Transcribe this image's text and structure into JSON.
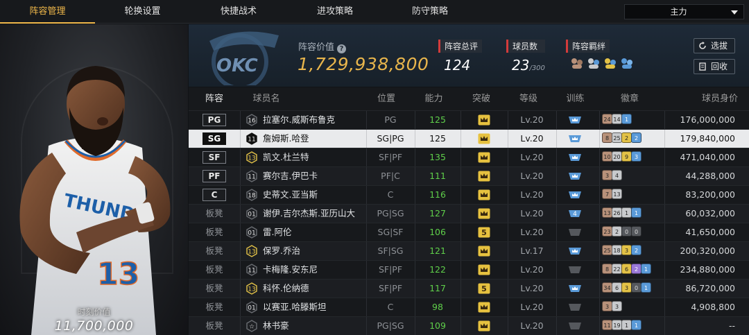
{
  "nav": {
    "tabs": [
      "阵容管理",
      "轮换设置",
      "快捷战术",
      "进攻策略",
      "防守策略"
    ],
    "active_tab": 0,
    "lineup_select": "主力"
  },
  "featured_player": {
    "market_label": "时刻价值",
    "market_value": "11,700,000",
    "jersey_number": "13"
  },
  "header": {
    "team_logo_text": "OKC",
    "lineup_value_label": "阵容价值",
    "lineup_value": "1,729,938,800",
    "total_rating_label": "阵容总评",
    "total_rating": "124",
    "player_count_label": "球员数",
    "player_count": "23",
    "player_count_max": "/300",
    "bond_label": "阵容羁绊",
    "select_button": "选拔",
    "recycle_button": "回收"
  },
  "table": {
    "columns": [
      "阵容",
      "球员名",
      "位置",
      "能力",
      "突破",
      "等级",
      "训练",
      "徽章",
      "球员身价"
    ],
    "rows": [
      {
        "slot": "PG",
        "starter": true,
        "number": "16",
        "name": "拉塞尔.威斯布鲁克",
        "position": "PG",
        "ability": "125",
        "ability_green": true,
        "breakthrough": "crown",
        "level": "Lv.20",
        "training": "crown",
        "badges": [
          [
            "24",
            "bronze"
          ],
          [
            "14",
            "silver"
          ],
          [
            "1",
            "blue"
          ]
        ],
        "price": "176,000,000"
      },
      {
        "slot": "SG",
        "starter": true,
        "selected": true,
        "number": "11",
        "name": "詹姆斯.哈登",
        "position": "SG|PG",
        "ability": "125",
        "ability_green": false,
        "breakthrough": "crown",
        "level": "Lv.20",
        "training": "crown",
        "badges": [
          [
            "8",
            "bronze"
          ],
          [
            "25",
            "silver"
          ],
          [
            "2",
            "gold"
          ],
          [
            "2",
            "blue"
          ]
        ],
        "price": "179,840,000"
      },
      {
        "slot": "SF",
        "starter": true,
        "number": "13",
        "name": "凯文.杜兰特",
        "position": "SF|PF",
        "ability": "135",
        "ability_green": true,
        "breakthrough": "crown",
        "level": "Lv.20",
        "training": "crown",
        "badges": [
          [
            "10",
            "bronze"
          ],
          [
            "20",
            "silver"
          ],
          [
            "9",
            "gold"
          ],
          [
            "3",
            "blue"
          ]
        ],
        "price": "471,040,000"
      },
      {
        "slot": "PF",
        "starter": true,
        "number": "11",
        "name": "赛尔吉.伊巴卡",
        "position": "PF|C",
        "ability": "111",
        "ability_green": true,
        "breakthrough": "crown",
        "level": "Lv.20",
        "training": "crown",
        "badges": [
          [
            "3",
            "bronze"
          ],
          [
            "4",
            "silver"
          ]
        ],
        "price": "44,288,000"
      },
      {
        "slot": "C",
        "starter": true,
        "number": "18",
        "name": "史蒂文.亚当斯",
        "position": "C",
        "ability": "116",
        "ability_green": true,
        "breakthrough": "crown",
        "level": "Lv.20",
        "training": "crown",
        "badges": [
          [
            "7",
            "bronze"
          ],
          [
            "13",
            "silver"
          ]
        ],
        "price": "83,200,000"
      },
      {
        "slot": "板凳",
        "starter": false,
        "number": "01",
        "name": "谢伊.吉尔杰斯.亚历山大",
        "position": "PG|SG",
        "ability": "127",
        "ability_green": true,
        "breakthrough": "crown",
        "level": "Lv.20",
        "training": "4",
        "badges": [
          [
            "13",
            "bronze"
          ],
          [
            "26",
            "silver"
          ],
          [
            "1",
            "silver"
          ],
          [
            "1",
            "blue"
          ]
        ],
        "price": "60,032,000"
      },
      {
        "slot": "板凳",
        "starter": false,
        "number": "01",
        "name": "雷.阿伦",
        "position": "SG|SF",
        "ability": "106",
        "ability_green": true,
        "breakthrough": "5",
        "level": "Lv.20",
        "training": "none",
        "badges": [
          [
            "23",
            "bronze"
          ],
          [
            "2",
            "silver"
          ],
          [
            "0",
            "dark"
          ],
          [
            "0",
            "dark"
          ]
        ],
        "price": "41,650,000"
      },
      {
        "slot": "板凳",
        "starter": false,
        "number": "13",
        "name": "保罗.乔治",
        "position": "SF|SG",
        "ability": "121",
        "ability_green": true,
        "breakthrough": "crown",
        "level": "Lv.17",
        "training": "crown",
        "badges": [
          [
            "25",
            "bronze"
          ],
          [
            "18",
            "silver"
          ],
          [
            "3",
            "gold"
          ],
          [
            "2",
            "blue"
          ]
        ],
        "price": "200,320,000"
      },
      {
        "slot": "板凳",
        "starter": false,
        "number": "11",
        "name": "卡梅隆.安东尼",
        "position": "SF|PF",
        "ability": "122",
        "ability_green": true,
        "breakthrough": "crown",
        "level": "Lv.20",
        "training": "none",
        "badges": [
          [
            "8",
            "bronze"
          ],
          [
            "22",
            "silver"
          ],
          [
            "6",
            "gold"
          ],
          [
            "2",
            "purple"
          ],
          [
            "1",
            "blue"
          ]
        ],
        "price": "234,880,000"
      },
      {
        "slot": "板凳",
        "starter": false,
        "number": "13",
        "name": "科怀.伦纳德",
        "position": "SF|PF",
        "ability": "117",
        "ability_green": true,
        "breakthrough": "5",
        "level": "Lv.20",
        "training": "crown",
        "badges": [
          [
            "34",
            "bronze"
          ],
          [
            "6",
            "silver"
          ],
          [
            "3",
            "gold"
          ],
          [
            "0",
            "dark"
          ],
          [
            "1",
            "blue"
          ]
        ],
        "price": "86,720,000"
      },
      {
        "slot": "板凳",
        "starter": false,
        "number": "01",
        "name": "以赛亚.哈滕斯坦",
        "position": "C",
        "ability": "98",
        "ability_green": true,
        "breakthrough": "crown",
        "level": "Lv.20",
        "training": "none",
        "badges": [
          [
            "3",
            "bronze"
          ],
          [
            "3",
            "silver"
          ]
        ],
        "price": "4,908,800"
      },
      {
        "slot": "板凳",
        "starter": false,
        "number": "☆",
        "name": "林书豪",
        "position": "PG|SG",
        "ability": "109",
        "ability_green": true,
        "breakthrough": "crown",
        "level": "Lv.20",
        "training": "none",
        "badges": [
          [
            "11",
            "bronze"
          ],
          [
            "19",
            "silver"
          ],
          [
            "1",
            "silver"
          ],
          [
            "1",
            "blue"
          ]
        ],
        "price": "--"
      }
    ]
  }
}
